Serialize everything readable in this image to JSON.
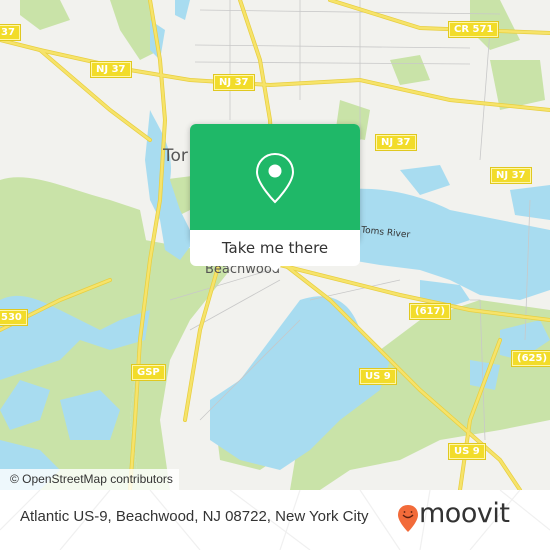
{
  "map": {
    "attribution": "© OpenStreetMap contributors",
    "colors": {
      "land": "#f2f2ee",
      "water": "#a8dcf0",
      "park": "#c9e3a8",
      "road": "#f6e36a",
      "road_outline": "#e8cf40",
      "minor_road": "#c8c8c8"
    },
    "place_labels": [
      {
        "text": "Toms River",
        "partial": "Tor"
      },
      {
        "text": "Beachwood"
      }
    ],
    "water_labels": [
      {
        "text": "Toms River"
      }
    ],
    "road_shields": [
      {
        "text": "37",
        "ref": "nj37-west"
      },
      {
        "text": "NJ 37",
        "ref": "nj37-a"
      },
      {
        "text": "NJ 37",
        "ref": "nj37-b"
      },
      {
        "text": "NJ 37",
        "ref": "nj37-c"
      },
      {
        "text": "NJ 37",
        "ref": "nj37-d"
      },
      {
        "text": "CR 571",
        "ref": "cr571"
      },
      {
        "text": "(617)",
        "ref": "cr617"
      },
      {
        "text": "(625)",
        "ref": "cr625"
      },
      {
        "text": "US 9",
        "ref": "us9-a"
      },
      {
        "text": "US 9",
        "ref": "us9-b"
      },
      {
        "text": "530",
        "ref": "cr530"
      },
      {
        "text": "GSP",
        "ref": "gsp"
      }
    ]
  },
  "popup": {
    "icon": "map-pin-icon",
    "cta_label": "Take me there",
    "color": "#1fb868"
  },
  "footer": {
    "address": "Atlantic US-9, Beachwood, NJ 08722, New York City",
    "brand": "moovit",
    "brand_color": "#f26b3a"
  }
}
